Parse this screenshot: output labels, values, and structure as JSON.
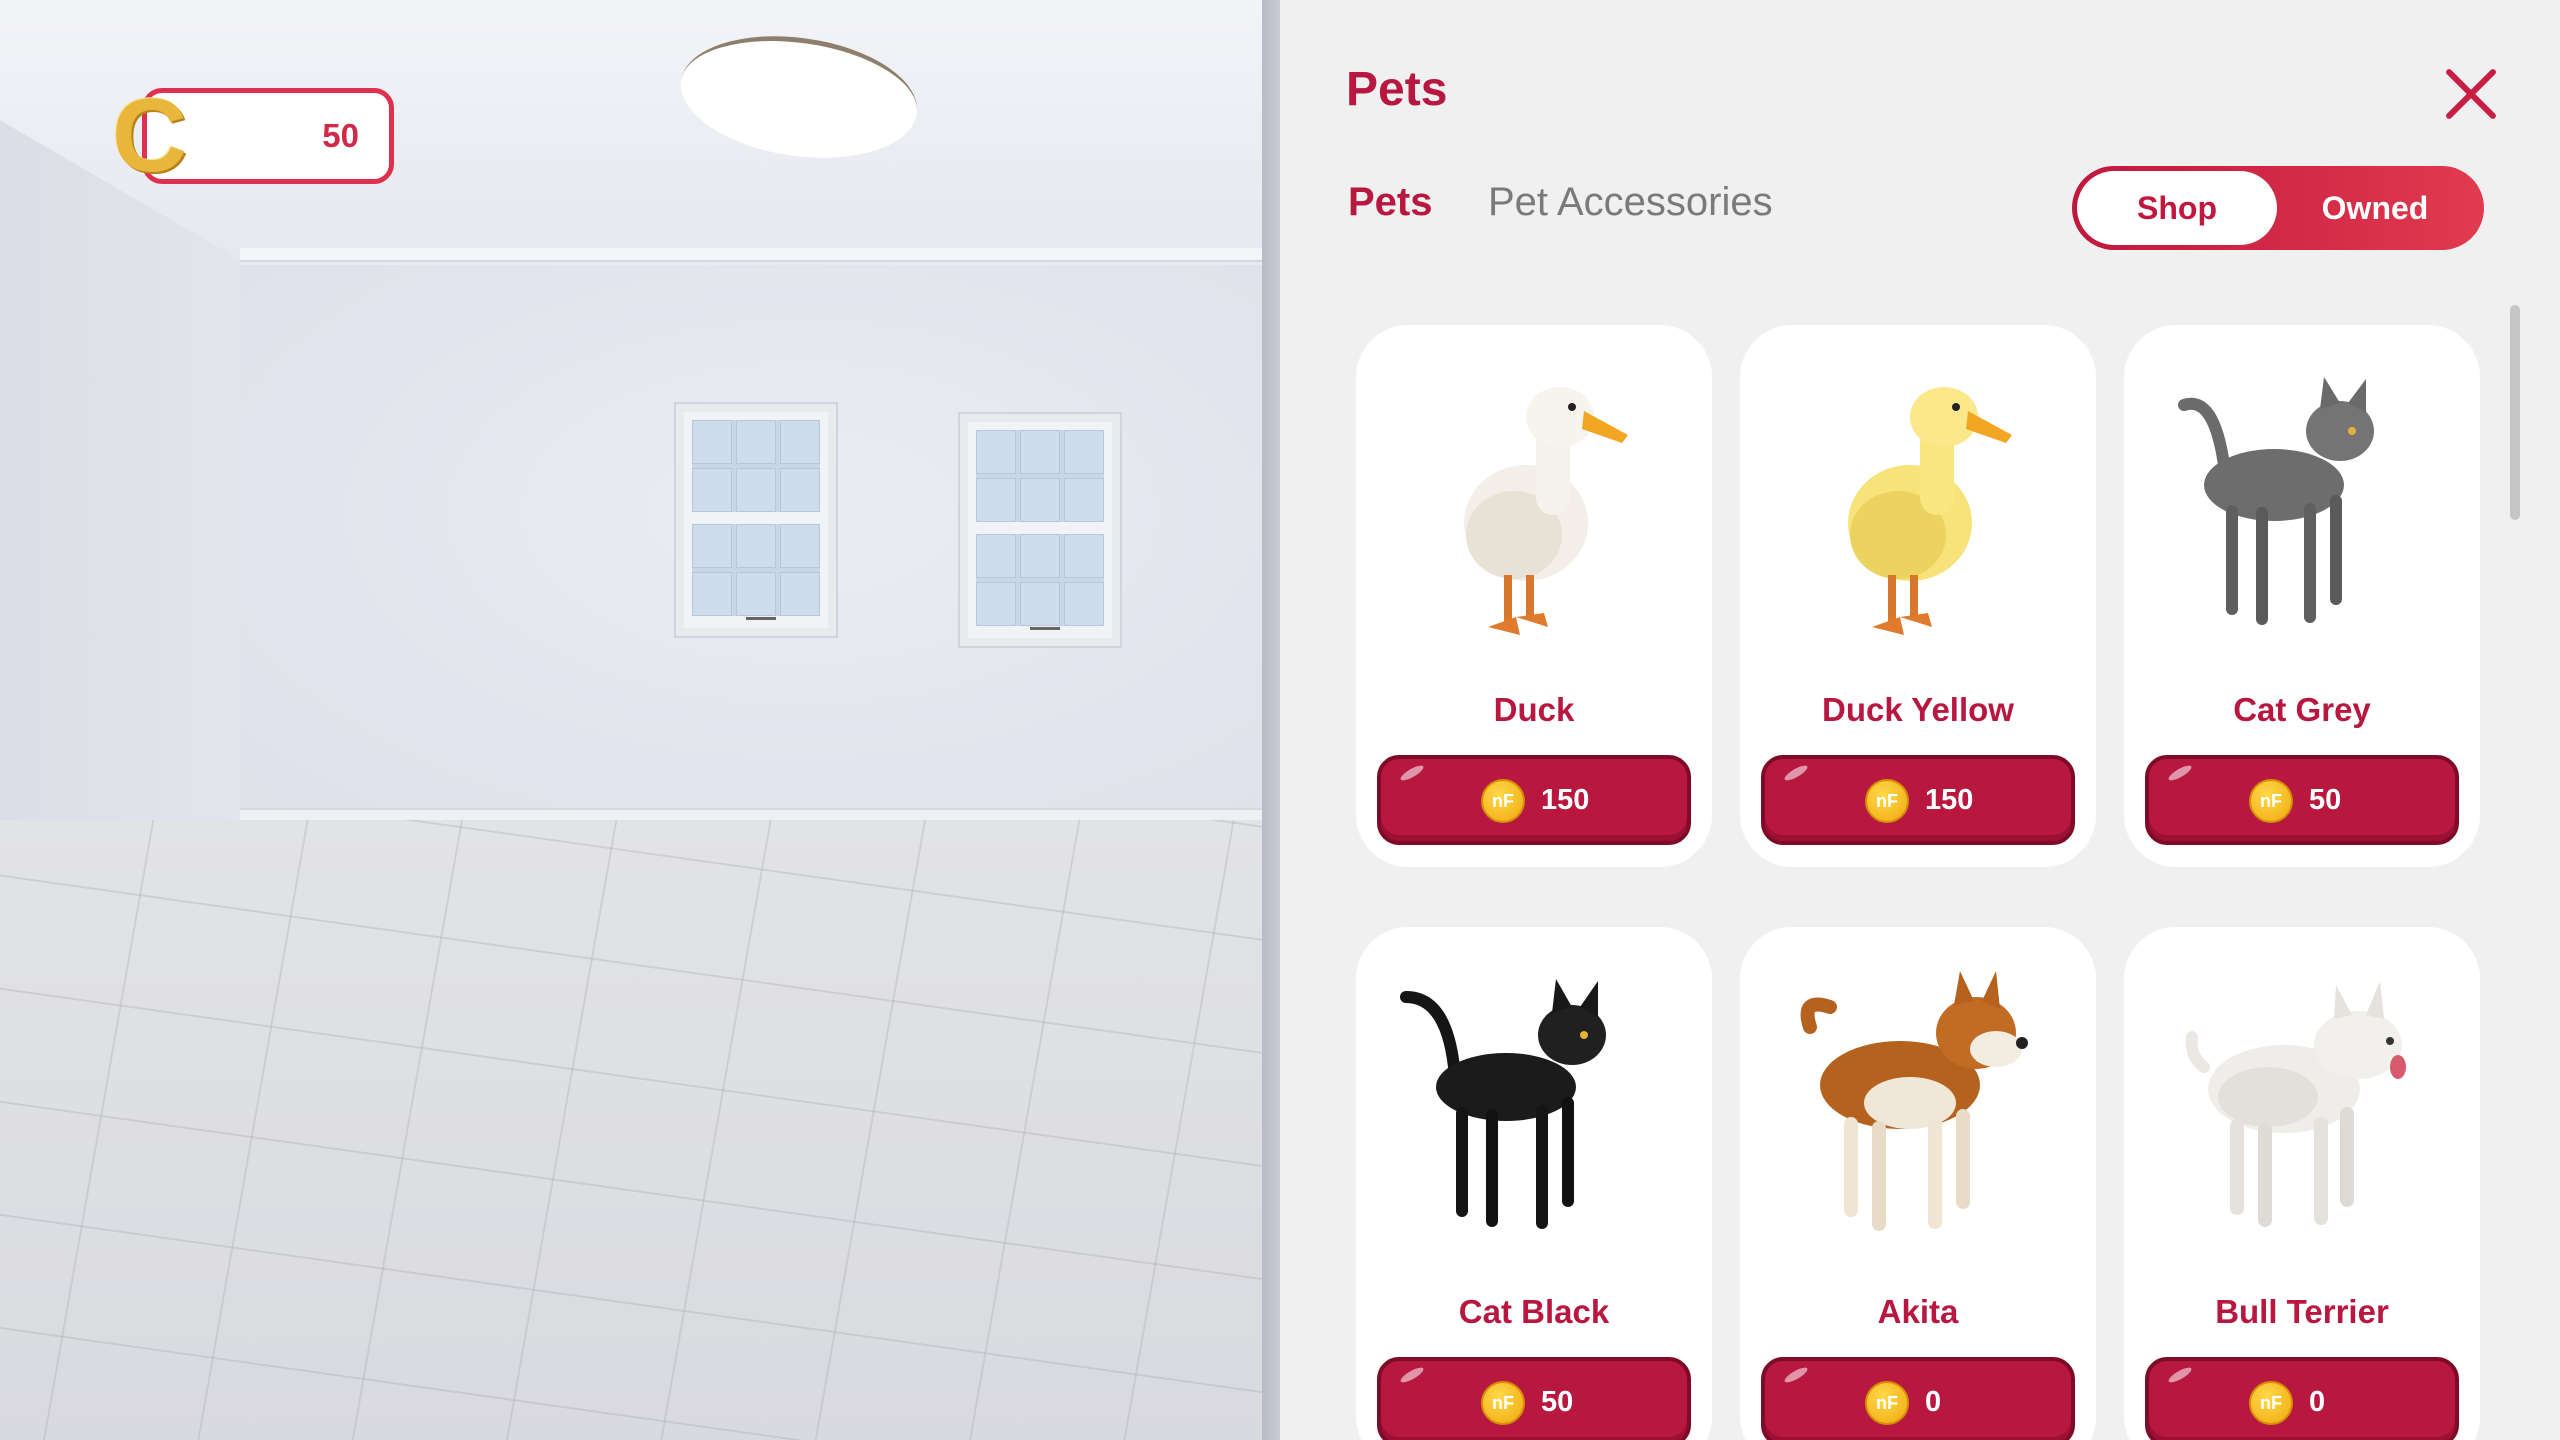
{
  "hud": {
    "coin_icon": "C",
    "coin_value": "50"
  },
  "panel": {
    "title": "Pets",
    "close_icon": "close-icon"
  },
  "tabs": [
    {
      "label": "Pets",
      "active": true
    },
    {
      "label": "Pet Accessories",
      "active": false
    }
  ],
  "toggle": {
    "shop_label": "Shop",
    "owned_label": "Owned",
    "selected": "Shop"
  },
  "currency_glyph": "nF",
  "pets": [
    {
      "name": "Duck",
      "price": "150",
      "icon": "white-duck"
    },
    {
      "name": "Duck Yellow",
      "price": "150",
      "icon": "yellow-duck"
    },
    {
      "name": "Cat Grey",
      "price": "50",
      "icon": "grey-cat"
    },
    {
      "name": "Cat Black",
      "price": "50",
      "icon": "black-cat"
    },
    {
      "name": "Akita",
      "price": "0",
      "icon": "akita-dog"
    },
    {
      "name": "Bull Terrier",
      "price": "0",
      "icon": "bull-terrier-dog"
    }
  ],
  "colors": {
    "accent": "#b8173f",
    "accent_dark": "#7e0b28",
    "coin_gold": "#f1a90d"
  }
}
